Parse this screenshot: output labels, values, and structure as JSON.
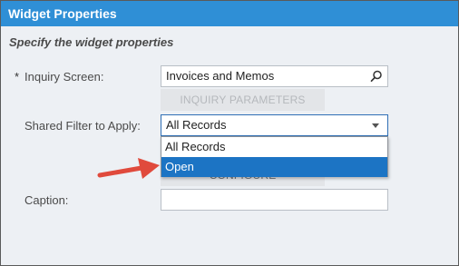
{
  "dialog": {
    "title": "Widget Properties",
    "subtitle": "Specify the widget properties"
  },
  "form": {
    "required_marker": "*",
    "inquiry_screen": {
      "label": "Inquiry Screen:",
      "value": "Invoices and Memos",
      "icon": "search-icon"
    },
    "inquiry_parameters_button": "INQUIRY PARAMETERS",
    "shared_filter": {
      "label": "Shared Filter to Apply:",
      "value": "All Records",
      "options": [
        "All Records",
        "Open"
      ],
      "highlighted": "Open"
    },
    "configure_button": "CONFIGURE",
    "caption": {
      "label": "Caption:",
      "value": ""
    }
  },
  "colors": {
    "title_bar": "#2f8fd6",
    "highlight": "#1c74c4",
    "arrow": "#e04a3c"
  }
}
